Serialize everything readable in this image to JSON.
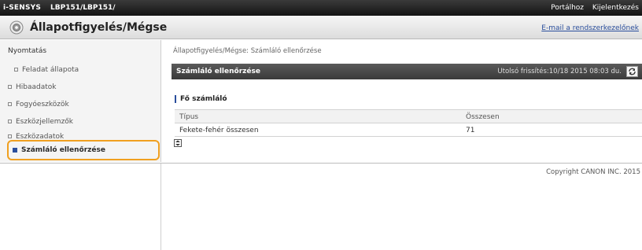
{
  "header": {
    "brand": "i-SENSYS",
    "model": "LBP151/LBP151/",
    "links": [
      "Portálhoz",
      "Kijelentkezés"
    ]
  },
  "titlebar": {
    "icon": "status-monitor-icon",
    "title": "Állapotfigyelés/Mégse",
    "mail_link": "E-mail a rendszerkezelőnek"
  },
  "sidebar": {
    "heading": "Nyomtatás",
    "items": [
      {
        "label": "Feladat állapota",
        "icon": "bullet-square-icon"
      },
      {
        "label": "Hibaadatok",
        "icon": "bullet-square-icon"
      },
      {
        "label": "Fogyóeszközök",
        "icon": "bullet-square-icon"
      },
      {
        "label": "Eszközjellemzők",
        "icon": "bullet-square-icon"
      },
      {
        "label": "Eszközadatok",
        "icon": "bullet-square-icon"
      }
    ],
    "active_item": {
      "label": "Számláló ellenőrzése",
      "icon": "bullet-filled-icon"
    }
  },
  "main": {
    "breadcrumb": "Állapotfigyelés/Mégse: Számláló ellenőrzése",
    "panel_title": "Számláló ellenőrzése",
    "updated": "Utolsó frissítés:10/18 2015 08:03 du.",
    "refresh_icon": "refresh-icon",
    "section_title": "Fő számláló",
    "columns": [
      "Típus",
      "Összesen"
    ],
    "rows": [
      {
        "type": "Fekete-fehér összesen",
        "total": "71"
      }
    ],
    "expand_icon": "expand-icon"
  },
  "footer": {
    "copyright": "Copyright CANON INC. 2015"
  },
  "colors": {
    "highlight": "#f0a020",
    "accent": "#2a4e9c",
    "topbar": "#141414"
  }
}
